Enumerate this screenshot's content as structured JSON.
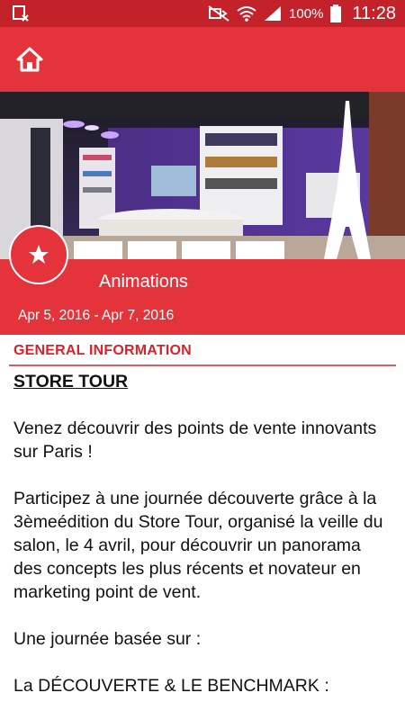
{
  "status_bar": {
    "battery_percent": "100%",
    "time": "11:28"
  },
  "app_bar": {
    "home_icon": "home-icon"
  },
  "event": {
    "title": "Animations",
    "dates": "Apr 5, 2016 - Apr 7, 2016",
    "badge_icon": "star-icon"
  },
  "section": {
    "heading": "GENERAL INFORMATION"
  },
  "description": {
    "title": "STORE TOUR",
    "paragraphs": [
      "Venez découvrir des points de vente innovants sur Paris !",
      "Participez à une journée découverte grâce à la 3èmeédition du Store Tour, organisé la veille du salon, le 4 avril, pour découvrir un panorama des concepts les plus récents et novateur en marketing point de vent.",
      "Une journée basée sur :",
      "La DÉCOUVERTE & LE BENCHMARK :"
    ]
  },
  "colors": {
    "status_bar": "#c4222b",
    "accent": "#e4333a",
    "heading": "#d8232a"
  }
}
